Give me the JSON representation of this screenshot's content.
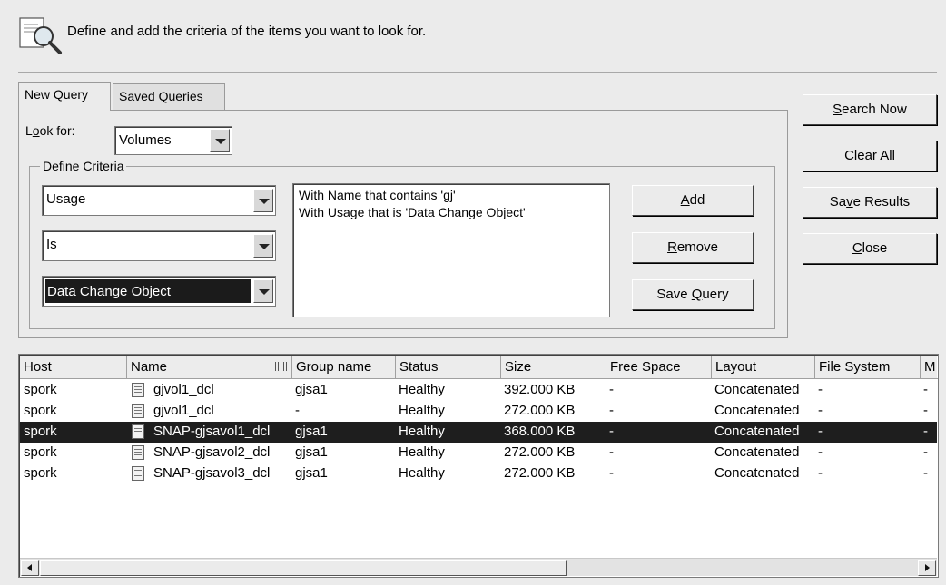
{
  "header": {
    "text": "Define and add the criteria of the items you want to look for."
  },
  "tabs": [
    {
      "label": "New Query",
      "selected": true
    },
    {
      "label": "Saved Queries",
      "selected": false
    }
  ],
  "lookfor": {
    "label_pre": "L",
    "label_accel": "o",
    "label_post": "ok for:",
    "value": "Volumes"
  },
  "criteria": {
    "legend": "Define Criteria",
    "attribute": "Usage",
    "operator": "Is",
    "value": "Data Change Object",
    "list": [
      "With Name that contains 'gj'",
      "With Usage that is 'Data Change Object'"
    ],
    "buttons": {
      "add": {
        "pre": "",
        "accel": "A",
        "post": "dd"
      },
      "remove": {
        "pre": "",
        "accel": "R",
        "post": "emove"
      },
      "save_query": {
        "pre": "Save ",
        "accel": "Q",
        "post": "uery"
      }
    }
  },
  "actions": {
    "search_now": {
      "pre": "",
      "accel": "S",
      "post": "earch Now"
    },
    "clear_all": {
      "pre": "Cl",
      "accel": "e",
      "post": "ar All"
    },
    "save_results": {
      "pre": "Sa",
      "accel": "v",
      "post": "e Results"
    },
    "close": {
      "pre": "",
      "accel": "C",
      "post": "lose"
    }
  },
  "grid": {
    "columns": [
      "Host",
      "Name",
      "Group name",
      "Status",
      "Size",
      "Free Space",
      "Layout",
      "File System",
      "M"
    ],
    "rows": [
      {
        "host": "spork",
        "name": "gjvol1_dcl",
        "group": "gjsa1",
        "status": "Healthy",
        "size": "392.000 KB",
        "free": "-",
        "layout": "Concatenated",
        "fs": "-",
        "m": "-",
        "selected": false
      },
      {
        "host": "spork",
        "name": "gjvol1_dcl",
        "group": "-",
        "status": "Healthy",
        "size": "272.000 KB",
        "free": "-",
        "layout": "Concatenated",
        "fs": "-",
        "m": "-",
        "selected": false
      },
      {
        "host": "spork",
        "name": "SNAP-gjsavol1_dcl",
        "group": "gjsa1",
        "status": "Healthy",
        "size": "368.000 KB",
        "free": "-",
        "layout": "Concatenated",
        "fs": "-",
        "m": "-",
        "selected": true
      },
      {
        "host": "spork",
        "name": "SNAP-gjsavol2_dcl",
        "group": "gjsa1",
        "status": "Healthy",
        "size": "272.000 KB",
        "free": "-",
        "layout": "Concatenated",
        "fs": "-",
        "m": "-",
        "selected": false
      },
      {
        "host": "spork",
        "name": "SNAP-gjsavol3_dcl",
        "group": "gjsa1",
        "status": "Healthy",
        "size": "272.000 KB",
        "free": "-",
        "layout": "Concatenated",
        "fs": "-",
        "m": "-",
        "selected": false
      }
    ]
  },
  "colors": {
    "dialog_bg": "#ebebeb",
    "selection": "#1e1e1e"
  },
  "icons": {
    "header": "search-document-icon",
    "row": "volume-icon",
    "sort": "column-chooser-icon"
  }
}
